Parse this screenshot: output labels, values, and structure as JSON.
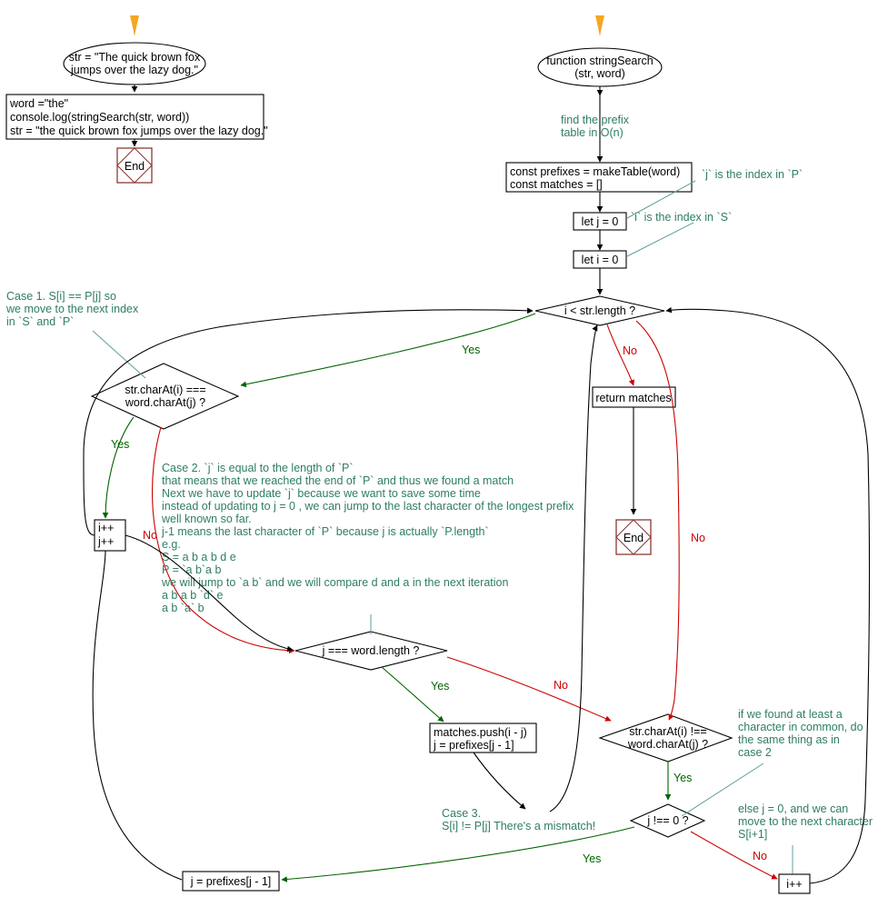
{
  "diagram": {
    "title": "stringSearch KMP flowchart",
    "colors": {
      "start_marker": "#f5a623",
      "yes_edge": "#006400",
      "no_edge": "#cc0000",
      "note": "#2e7d64",
      "note_leader": "#5f9ea0",
      "end_shape": "#8b3a32",
      "default_edge": "#000000"
    }
  },
  "left_flow": {
    "start_marker": "start-arrow",
    "terminal": {
      "line1": "str = \"The quick brown fox",
      "line2": "jumps over the lazy dog.\""
    },
    "process": {
      "line1": "word =\"the\"",
      "line2": "console.log(stringSearch(str, word))",
      "line3": "str = \"the quick brown fox jumps over the lazy dog.\""
    },
    "end_label": "End"
  },
  "right_flow": {
    "start_marker": "start-arrow",
    "terminal": {
      "line1": "function stringSearch",
      "line2": "(str, word)"
    },
    "note_prefix_table": {
      "line1": "find the prefix",
      "line2": "table in O(n)"
    },
    "init_box": {
      "line1": "const prefixes = makeTable(word)",
      "line2": "const matches = []"
    },
    "note_j_index": "`j` is the index in `P`",
    "let_j": "let j = 0",
    "note_i_index": "`i` is the index in `S`",
    "let_i": "let i = 0",
    "loop_condition": "i < str.length ?",
    "return_box": "return matches",
    "end_label": "End"
  },
  "decisions": {
    "char_equal": {
      "line1": "str.charAt(i) ===",
      "line2": "word.charAt(j) ?"
    },
    "j_equals_wordlength": "j === word.length ?",
    "char_not_equal": {
      "line1": "str.charAt(i) !==",
      "line2": "word.charAt(j) ?"
    },
    "j_not_zero": "j !== 0 ?"
  },
  "actions": {
    "increment_both": {
      "line1": "i++",
      "line2": "j++"
    },
    "push_match": {
      "line1": "matches.push(i - j)",
      "line2": "j = prefixes[j - 1]"
    },
    "reset_j": "j = prefixes[j - 1]",
    "increment_i": "i++"
  },
  "edge_labels": {
    "loop_yes": "Yes",
    "loop_no": "No",
    "loop_no_right": "No",
    "char_equal_yes": "Yes",
    "char_equal_no": "No",
    "j_len_yes": "Yes",
    "j_len_no": "No",
    "char_neq_yes": "Yes",
    "j_nz_yes": "Yes",
    "j_nz_no": "No"
  },
  "notes": {
    "case1": {
      "line1": "Case 1. S[i] == P[j] so",
      "line2": "we move to the next index",
      "line3": "in `S` and `P`"
    },
    "case2": {
      "line1": "Case 2. `j` is equal to the length of `P`",
      "line2": "that means that we reached the end of `P` and thus we found a match",
      "line3": "Next we have to update `j` because we want to save some time",
      "line4": "instead of updating to j = 0 , we can jump to the last character of the longest prefix",
      "line5": "well known so far.",
      "line6": "j-1 means the last character of `P` because j is actually `P.length`",
      "line7": "e.g.",
      "line8": "S = a b a b d e",
      "line9": "P = `a b`a b",
      "line10": "we will jump to `a b` and we will compare d and a in the next iteration",
      "line11": "a b a b `d` e",
      "line12": "a b `a` b"
    },
    "case3": {
      "line1": "Case 3.",
      "line2": "S[i] != P[j] There's a mismatch!"
    },
    "found_common": {
      "line1": "if we found at least a",
      "line2": "character in common, do",
      "line3": "the same thing as in",
      "line4": "case 2"
    },
    "else_reset": {
      "line1": "else j = 0, and we can",
      "line2": "move to the next character",
      "line3": "S[i+1]"
    }
  }
}
